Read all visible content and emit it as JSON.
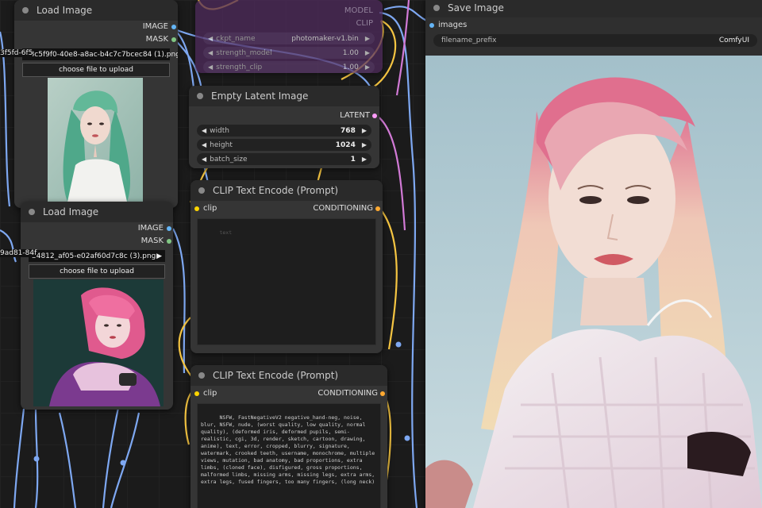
{
  "load_image_1": {
    "title": "Load Image",
    "out_image": "IMAGE",
    "out_mask": "MASK",
    "filename": "e8c5f9f0-40e8-a8ac-b4c7c7bcec84 (1).png",
    "left_overflow_text": "3f5fd-6f5",
    "upload_label": "choose file to upload"
  },
  "load_image_2": {
    "title": "Load Image",
    "out_image": "IMAGE",
    "out_mask": "MASK",
    "filename": "b4812_af05-e02af60d7c8c (3).png",
    "left_overflow_text": "9ad81-84f",
    "upload_label": "choose file to upload"
  },
  "photomaker_node": {
    "out_model": "MODEL",
    "out_clip": "CLIP",
    "widgets": [
      {
        "label": "ckpt_name",
        "value": "photomaker-v1.bin"
      },
      {
        "label": "strength_model",
        "value": "1.00"
      },
      {
        "label": "strength_clip",
        "value": "1.00"
      }
    ]
  },
  "empty_latent": {
    "title": "Empty Latent Image",
    "output": "LATENT",
    "widgets": [
      {
        "label": "width",
        "value": "768"
      },
      {
        "label": "height",
        "value": "1024"
      },
      {
        "label": "batch_size",
        "value": "1"
      }
    ]
  },
  "clip_positive": {
    "title": "CLIP Text Encode (Prompt)",
    "input": "clip",
    "output": "CONDITIONING",
    "placeholder": "text",
    "text": ""
  },
  "clip_negative": {
    "title": "CLIP Text Encode (Prompt)",
    "input": "clip",
    "output": "CONDITIONING",
    "text": "NSFW, FastNegativeV2 negative_hand-neg, noise, blur, NSFW, nude, (worst quality, low quality, normal quality), (deformed iris, deformed pupils, semi-realistic, cgi, 3d, render, sketch, cartoon, drawing, anime), text, error, cropped, blurry, signature, watermark, crooked teeth, username, monochrome, multiple views, mutation, bad anatomy, bad proportions, extra limbs, (cloned face), disfigured, gross proportions, malformed limbs, missing arms, missing legs, extra arms, extra legs, fused fingers, too many fingers, (long neck)"
  },
  "save_image": {
    "title": "Save Image",
    "input": "images",
    "widget_label": "filename_prefix",
    "widget_value": "ComfyUI"
  },
  "colors": {
    "canvas_bg": "#1b1b1b",
    "node_bg": "#353535",
    "node_title_bg": "#2a2a2a",
    "wire_blue": "#7ea8f2",
    "wire_yellow": "#f5c542",
    "wire_pink": "#d27ad6",
    "socket_latent": "#ff9cf9",
    "socket_clip": "#ffd500",
    "socket_image": "#64b5f6",
    "socket_mask": "#81c784"
  }
}
